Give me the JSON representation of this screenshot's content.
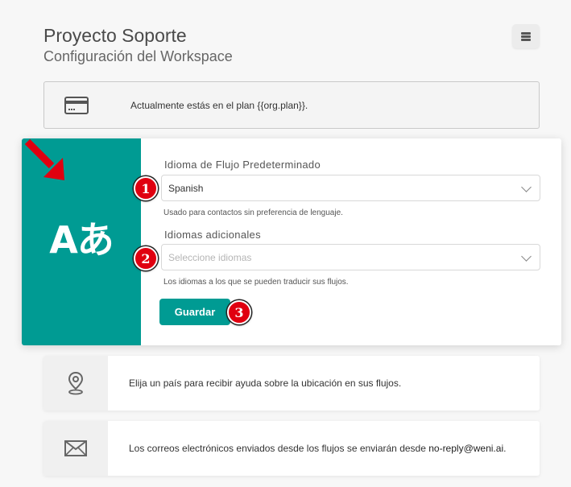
{
  "header": {
    "title": "Proyecto Soporte",
    "subtitle": "Configuración del Workspace"
  },
  "menu": {
    "icon": "hamburger-menu-icon"
  },
  "plan": {
    "icon": "credit-card-icon",
    "text": "Actualmente estás en el plan {{org.plan}}."
  },
  "language": {
    "icon": "translate-icon",
    "glyph": "Aあ",
    "default_flow_language": {
      "label": "Idioma de Flujo Predeterminado",
      "value": "Spanish",
      "help": "Usado para contactos sin preferencia de lenguaje."
    },
    "additional_languages": {
      "label": "Idiomas adicionales",
      "placeholder": "Seleccione idiomas",
      "help": "Los idiomas a los que se pueden traducir sus flujos."
    },
    "save_label": "Guardar"
  },
  "annotations": {
    "badges": [
      "1",
      "2",
      "3"
    ],
    "badge_color": "#e00010",
    "arrow_color": "#e00010"
  },
  "location": {
    "icon": "location-pin-icon",
    "text": "Elija un país para recibir ayuda sobre la ubicación en sus flujos."
  },
  "email": {
    "icon": "envelope-icon",
    "text": "Los correos electrónicos enviados desde los flujos se enviarán desde ",
    "address": "no-reply@weni.ai",
    "suffix": "."
  },
  "colors": {
    "accent": "#009b93",
    "background": "#f7f7f7"
  }
}
